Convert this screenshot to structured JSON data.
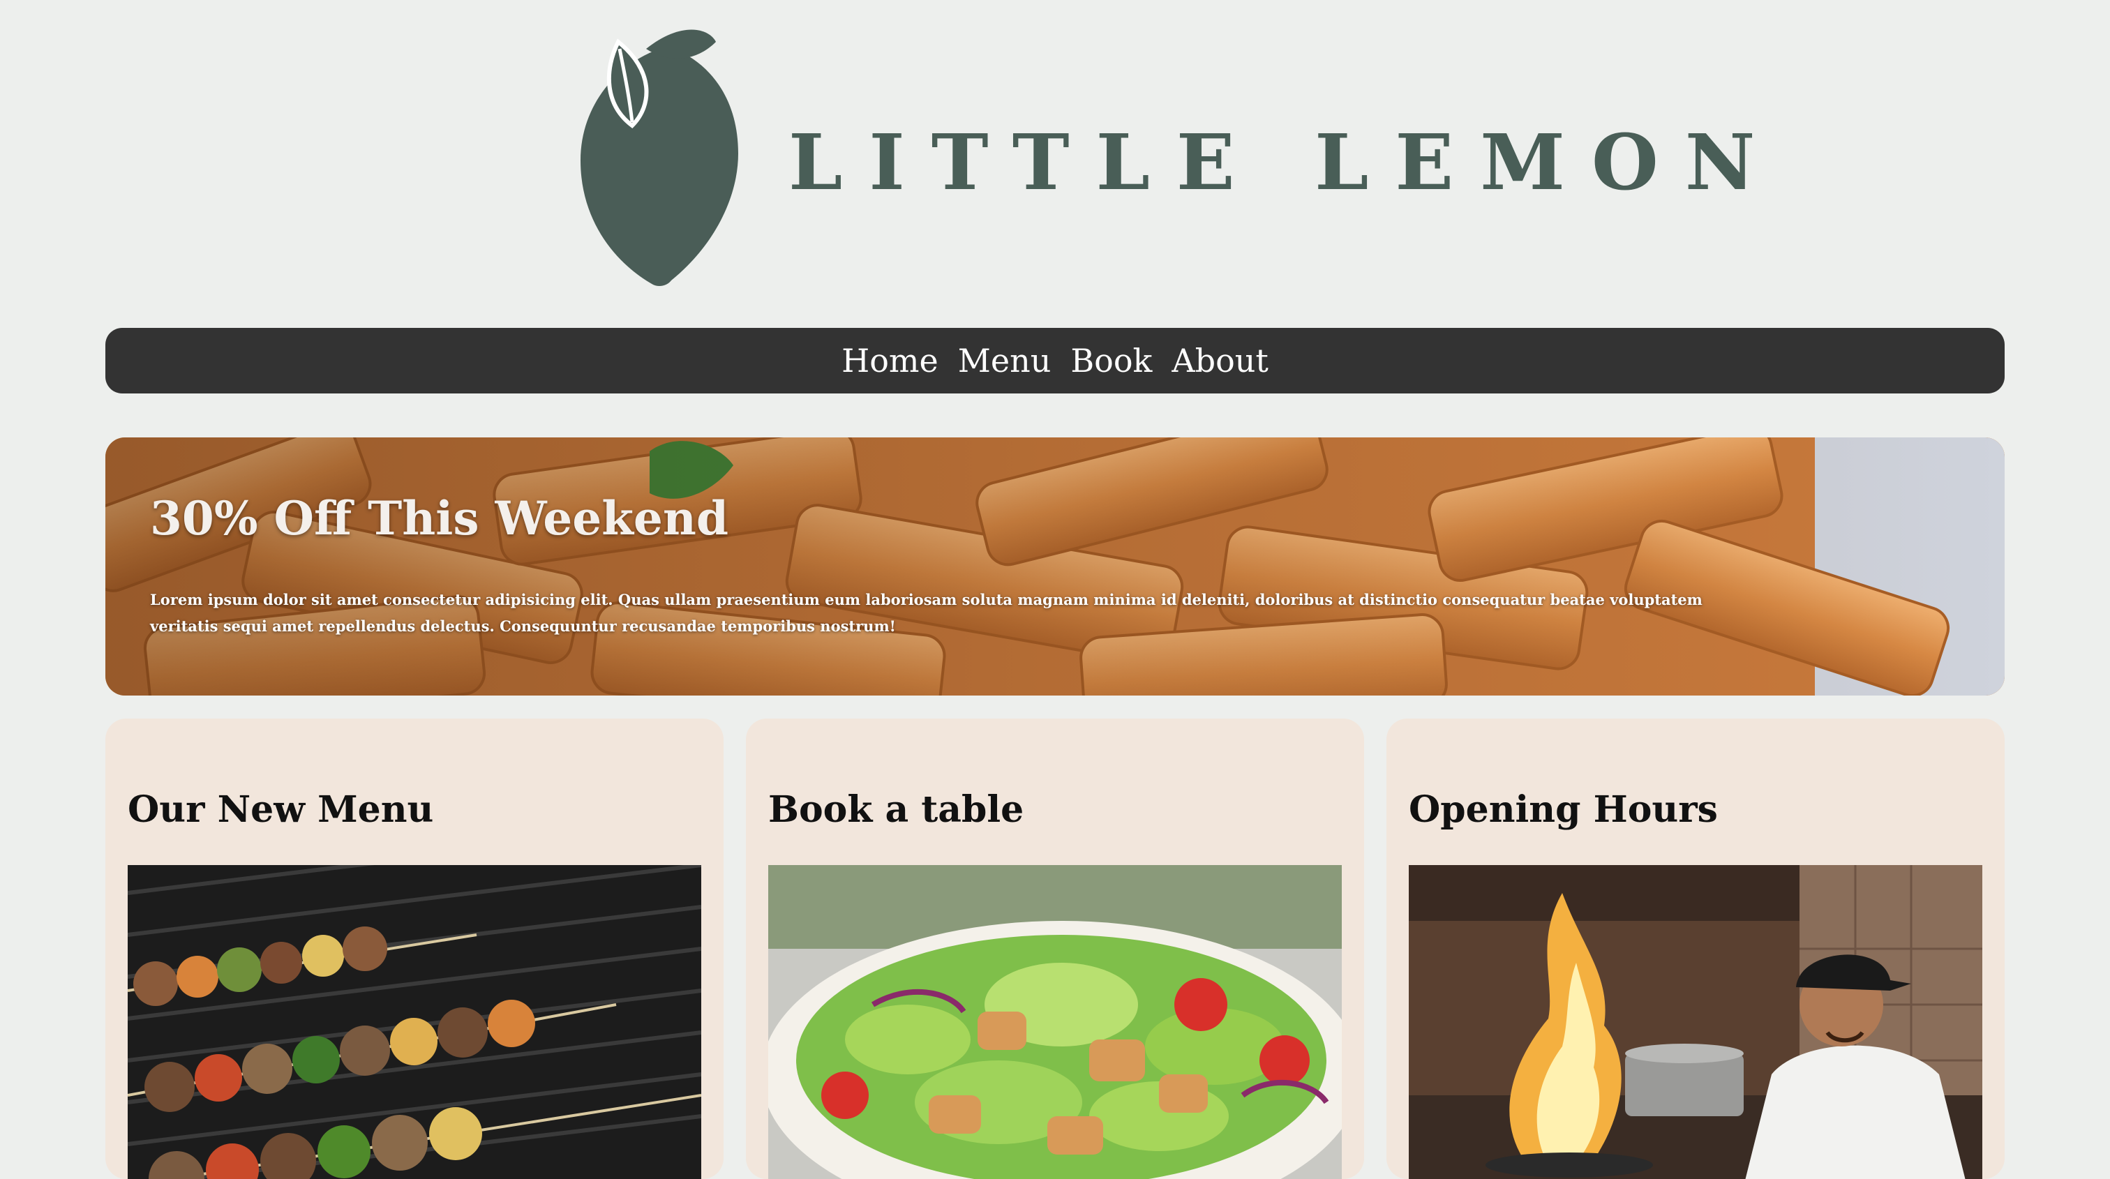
{
  "brand": {
    "name": "LITTLE LEMON",
    "logo_icon": "lemon-icon",
    "color": "#495e57"
  },
  "nav": {
    "items": [
      {
        "label": "Home"
      },
      {
        "label": "Menu"
      },
      {
        "label": "Book"
      },
      {
        "label": "About"
      }
    ]
  },
  "hero": {
    "title": "30% Off This Weekend",
    "text": "Lorem ipsum dolor sit amet consectetur adipisicing elit. Quas ullam praesentium eum laboriosam soluta magnam minima id deleniti, doloribus at distinctio consequatur beatae voluptatem veritatis sequi amet repellendus delectus. Consequuntur recusandae temporibus nostrum!",
    "image": "pasta-penne-photo"
  },
  "cards": [
    {
      "title": "Our New Menu",
      "image": "grilled-skewers-photo"
    },
    {
      "title": "Book a table",
      "image": "salad-bowl-photo"
    },
    {
      "title": "Opening Hours",
      "image": "chef-flambe-photo"
    }
  ],
  "colors": {
    "background": "#edefed",
    "nav_background": "#333333",
    "card_background": "#f2e6dc",
    "text_dark": "#111111"
  }
}
